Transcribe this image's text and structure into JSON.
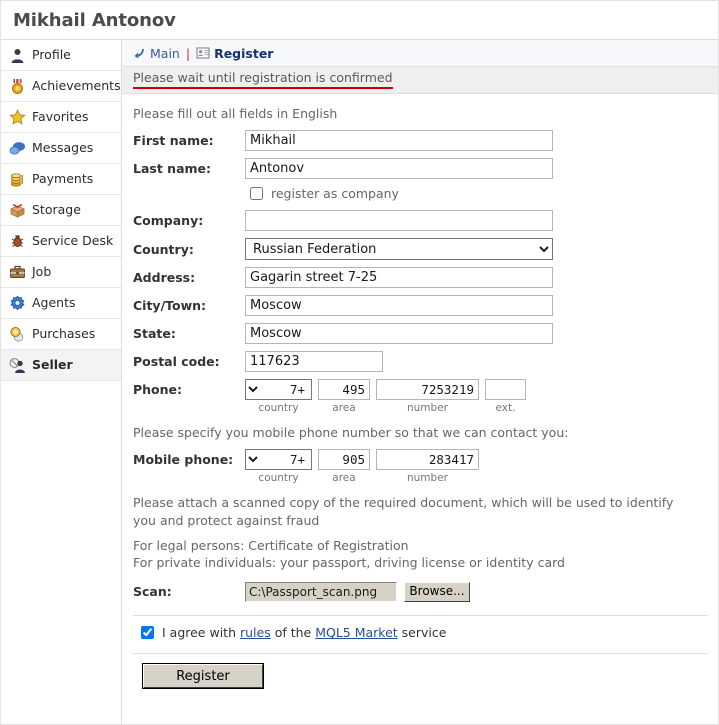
{
  "header": {
    "title": "Mikhail Antonov"
  },
  "sidebar": {
    "items": [
      {
        "label": "Profile",
        "icon": "user-icon",
        "active": false
      },
      {
        "label": "Achievements",
        "icon": "medal-icon",
        "active": false
      },
      {
        "label": "Favorites",
        "icon": "star-icon",
        "active": false
      },
      {
        "label": "Messages",
        "icon": "chat-bubble-icon",
        "active": false
      },
      {
        "label": "Payments",
        "icon": "coins-icon",
        "active": false
      },
      {
        "label": "Storage",
        "icon": "box-icon",
        "active": false
      },
      {
        "label": "Service Desk",
        "icon": "bug-icon",
        "active": false
      },
      {
        "label": "Job",
        "icon": "briefcase-icon",
        "active": false
      },
      {
        "label": "Agents",
        "icon": "gear-icon",
        "active": false
      },
      {
        "label": "Purchases",
        "icon": "coin-cart-icon",
        "active": false
      },
      {
        "label": "Seller",
        "icon": "seller-icon",
        "active": true
      }
    ]
  },
  "breadcrumb": {
    "back_icon": "back-arrow-icon",
    "main_label": "Main",
    "separator": "|",
    "current_icon": "id-card-icon",
    "current_label": "Register"
  },
  "notice": {
    "text": "Please wait until registration is confirmed",
    "underline_color": "#cc0000"
  },
  "form": {
    "intro_hint": "Please fill out all fields in English",
    "first_name": {
      "label": "First name:",
      "value": "Mikhail",
      "placeholder": ""
    },
    "last_name": {
      "label": "Last name:",
      "value": "Antonov",
      "placeholder": ""
    },
    "register_as_company": {
      "label": "register as company",
      "checked": false
    },
    "company": {
      "label": "Company:",
      "value": "",
      "placeholder": ""
    },
    "country": {
      "label": "Country:",
      "value": "Russian Federation",
      "options": [
        "Russian Federation"
      ]
    },
    "address": {
      "label": "Address:",
      "value": "Gagarin street 7-25",
      "placeholder": ""
    },
    "city": {
      "label": "City/Town:",
      "value": "Moscow",
      "placeholder": ""
    },
    "state": {
      "label": "State:",
      "value": "Moscow",
      "placeholder": ""
    },
    "postal_code": {
      "label": "Postal code:",
      "value": "117623",
      "placeholder": ""
    },
    "phone": {
      "label": "Phone:",
      "country": {
        "value": "+7",
        "caption": "country",
        "options": [
          "+7"
        ]
      },
      "area": {
        "value": "495",
        "caption": "area"
      },
      "number": {
        "value": "7253219",
        "caption": "number"
      },
      "ext": {
        "value": "",
        "caption": "ext."
      }
    },
    "mobile_hint": "Please specify you mobile phone number so that we can contact you:",
    "mobile_phone": {
      "label": "Mobile phone:",
      "country": {
        "value": "+7",
        "caption": "country",
        "options": [
          "+7"
        ]
      },
      "area": {
        "value": "905",
        "caption": "area"
      },
      "number": {
        "value": "283417",
        "caption": "number"
      }
    },
    "scan_hint_1": "Please attach a scanned copy of the required document, which will be used to identify you and protect against fraud",
    "scan_hint_2a": "For legal persons: Certificate of Registration",
    "scan_hint_2b": "For private individuals: your passport, driving license or identity card",
    "scan": {
      "label": "Scan:",
      "filename": "C:\\Passport_scan.png",
      "browse_label": "Browse..."
    },
    "agree": {
      "checked": true,
      "text_before": "I agree with ",
      "rules_link": "rules",
      "text_middle": " of the ",
      "market_link": "MQL5 Market",
      "text_after": " service"
    },
    "submit_label": "Register"
  }
}
